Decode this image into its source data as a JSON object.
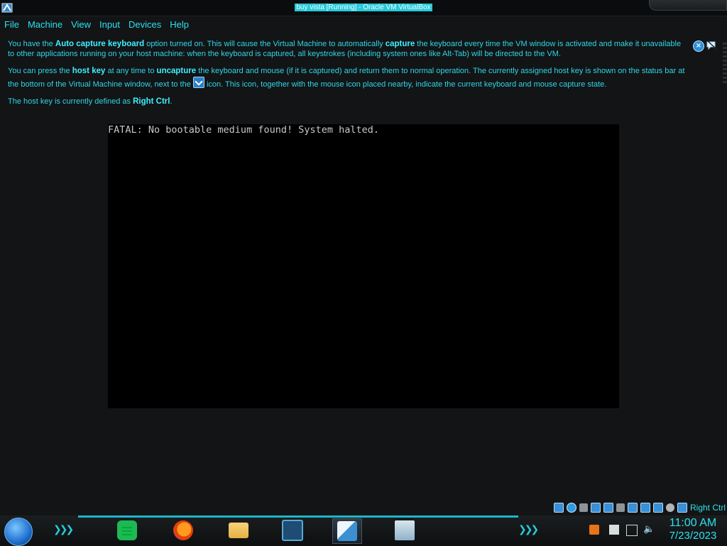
{
  "window": {
    "title": "buy vista [Running] - Oracle VM VirtualBox"
  },
  "menu": [
    "File",
    "Machine",
    "View",
    "Input",
    "Devices",
    "Help"
  ],
  "notice": {
    "p1": {
      "a": "You have the ",
      "b1": "Auto capture keyboard",
      "c": " option turned on. This will cause the Virtual Machine to automatically ",
      "b2": "capture",
      "d": " the keyboard every time the VM window is activated and make it unavailable to other applications running on your host machine: when the keyboard is captured, all keystrokes (including system ones like Alt-Tab) will be directed to the VM."
    },
    "p2": {
      "a": "You can press the ",
      "b1": "host key",
      "c": " at any time to ",
      "b2": "uncapture",
      "d": " the keyboard and mouse (if it is captured) and return them to normal operation. The currently assigned host key is shown on the status bar at the bottom of the Virtual Machine window, next to the ",
      "e": " icon. This icon, together with the mouse icon placed nearby, indicate the current keyboard and mouse capture state."
    },
    "p3": {
      "a": "The host key is currently defined as ",
      "b1": "Right Ctrl",
      "c": "."
    }
  },
  "vm": {
    "console_text": "FATAL: No bootable medium found! System halted."
  },
  "statusbar": {
    "host_key_label": "Right Ctrl"
  },
  "clock": {
    "time": "11:00 AM",
    "date": "7/23/2023"
  },
  "colors": {
    "accent": "#2fe0ee",
    "background": "#121416",
    "vm_bg": "#000000"
  }
}
